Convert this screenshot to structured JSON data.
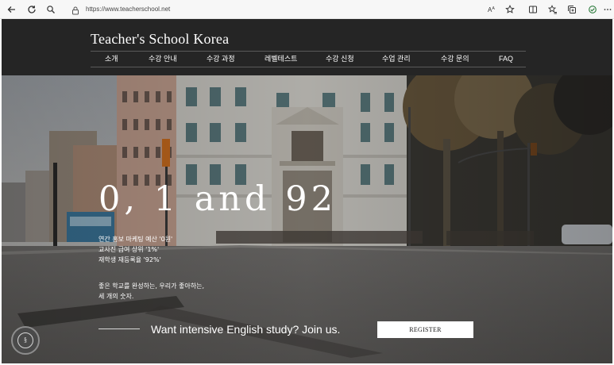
{
  "browser": {
    "url": "https://www.teacherschool.net",
    "icons": [
      "back-icon",
      "refresh-icon",
      "search-icon",
      "lock-icon",
      "read-aloud-icon",
      "favorite-icon",
      "split-screen-icon",
      "favorites-bar-icon",
      "collections-icon",
      "extensions-icon",
      "more-icon"
    ]
  },
  "site": {
    "title": "Teacher's School Korea",
    "nav": [
      "소개",
      "수강 안내",
      "수강 과정",
      "레벨테스트",
      "수강 신청",
      "수업 관리",
      "수강 문의",
      "FAQ"
    ]
  },
  "hero": {
    "headline": "0, 1 and 92",
    "stats": [
      "연간 홍보 마케팅 예산 '0원'",
      "교사진 급여 상위 '1%'",
      "재학생 재등록율 '92%'"
    ],
    "tagline": [
      "좋은 학교를 완성하는, 우리가 좋아하는,",
      "세 개의 숫자."
    ],
    "cta": "Want intensive English study? Join us.",
    "register_label": "REGISTER",
    "badge_icon": "school-seal-icon"
  },
  "colors": {
    "header_bg": "#252525",
    "hero_overlay": "#1c1c1c",
    "text": "#ffffff",
    "button_bg": "#ffffff"
  }
}
